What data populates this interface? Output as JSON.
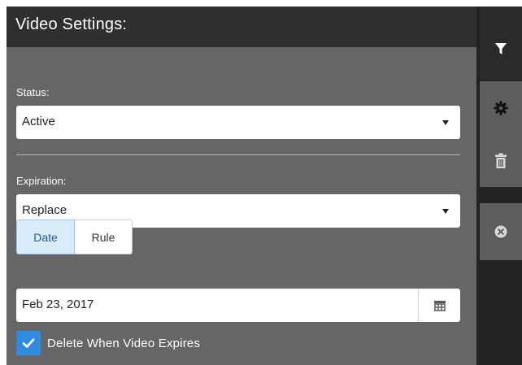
{
  "panel": {
    "title": "Video Settings:"
  },
  "status": {
    "label": "Status:",
    "value": "Active"
  },
  "expiration": {
    "label": "Expiration:",
    "value": "Replace",
    "mode_options": [
      "Date",
      "Rule"
    ],
    "selected_mode": "Date",
    "date_value": "Feb 23, 2017"
  },
  "delete_option": {
    "label": "Delete When Video Expires",
    "checked": true
  },
  "sidebar": {
    "icons": [
      "filter-icon",
      "gear-icon",
      "trash-icon",
      "close-circle-icon"
    ]
  },
  "colors": {
    "accent": "#2b8ce0",
    "header_bg": "#2f2f2f",
    "panel_bg": "#666666",
    "sidebar_bg": "#222222"
  }
}
